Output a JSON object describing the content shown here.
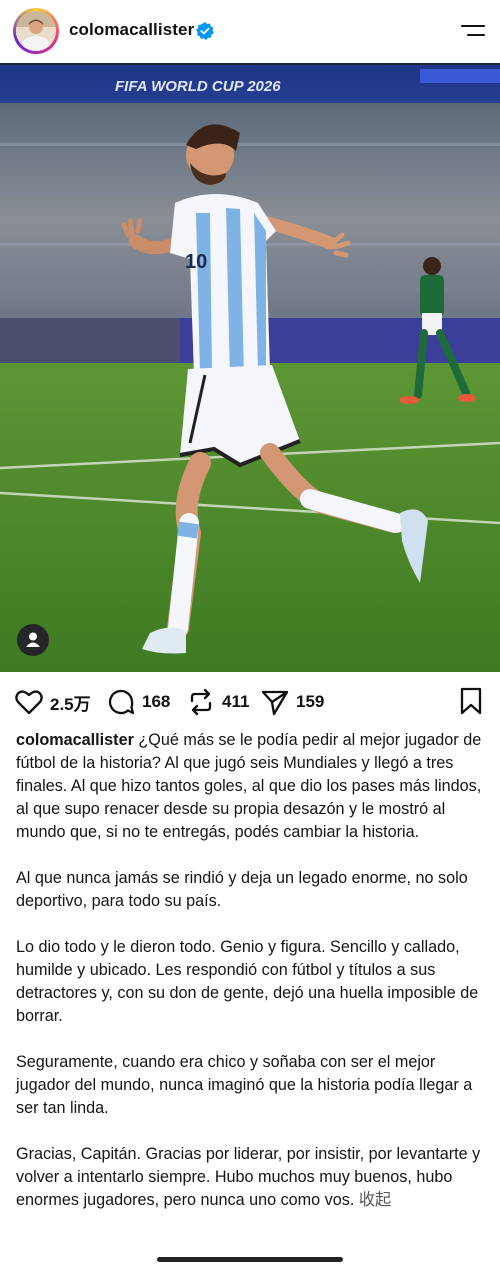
{
  "header": {
    "username": "colomacallister",
    "verified_icon": "verified-badge-icon",
    "menu_icon": "hamburger-menu-icon"
  },
  "photo": {
    "banner_text": "FIFA WORLD CUP 2026",
    "tag_icon": "user-tag-icon"
  },
  "actions": {
    "likes": "2.5万",
    "comments": "168",
    "reposts": "411",
    "shares": "159"
  },
  "caption": {
    "author": "colomacallister",
    "paragraphs": [
      "¿Qué más se le podía pedir al mejor jugador de fútbol de la historia? Al que jugó seis Mundiales y llegó a tres finales. Al que hizo tantos goles, al que dio los pases más lindos, al que supo renacer desde su propia desazón y le mostró al mundo que, si no te entregás, podés cambiar la historia.",
      "Al que nunca jamás se rindió y deja un legado enorme, no solo deportivo, para todo su país.",
      "Lo dio todo y le dieron todo. Genio y figura. Sencillo y callado, humilde y ubicado. Les respondió con fútbol y títulos a sus detractores y, con su don de gente, dejó una huella imposible de borrar.",
      "Seguramente, cuando era chico y soñaba con ser el mejor jugador del mundo, nunca imaginó que la historia podía llegar a ser tan linda.",
      "Gracias, Capitán. Gracias por liderar, por insistir, por levantarte y volver a intentarlo siempre. Hubo muchos muy buenos, hubo enormes jugadores, pero nunca uno como vos."
    ],
    "collapse_label": "收起"
  },
  "colors": {
    "accent_blue": "#0095f6",
    "text": "#111111",
    "pitch_green": "#4f8a2a"
  }
}
